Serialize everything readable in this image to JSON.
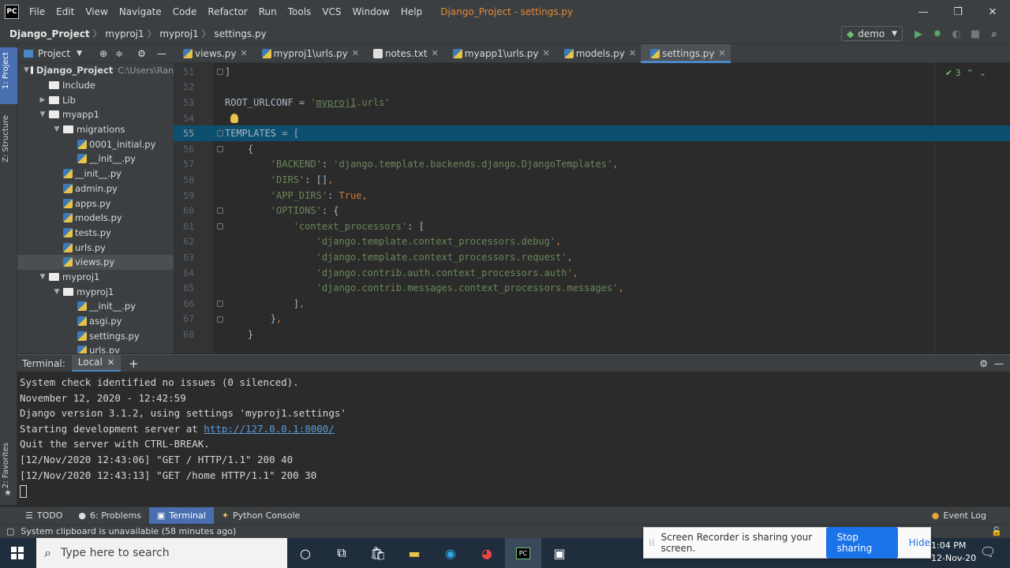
{
  "titlebar": {
    "logo": "PC",
    "menu": [
      "File",
      "Edit",
      "View",
      "Navigate",
      "Code",
      "Refactor",
      "Run",
      "Tools",
      "VCS",
      "Window",
      "Help"
    ],
    "title": "Django_Project - settings.py",
    "controls": [
      "—",
      "❐",
      "✕"
    ]
  },
  "navbar": {
    "crumbs": [
      "Django_Project",
      "myproj1",
      "myproj1",
      "settings.py"
    ],
    "run_config": "demo"
  },
  "left_strip": {
    "tab1": "1: Project",
    "tab2": "Z: Structure",
    "tab3": "2: Favorites"
  },
  "project_panel": {
    "title": "Project",
    "tree": [
      {
        "indent": 0,
        "type": "folder",
        "label": "Django_Project",
        "path": "C:\\Users\\Ran",
        "expanded": true,
        "bold": true
      },
      {
        "indent": 1,
        "type": "folder",
        "label": "Include"
      },
      {
        "indent": 1,
        "type": "folder",
        "label": "Lib",
        "collapsed": true
      },
      {
        "indent": 1,
        "type": "folder",
        "label": "myapp1",
        "expanded": true
      },
      {
        "indent": 2,
        "type": "folder",
        "label": "migrations",
        "expanded": true
      },
      {
        "indent": 3,
        "type": "py",
        "label": "0001_initial.py"
      },
      {
        "indent": 3,
        "type": "py",
        "label": "__init__.py"
      },
      {
        "indent": 2,
        "type": "py",
        "label": "__init__.py"
      },
      {
        "indent": 2,
        "type": "py",
        "label": "admin.py"
      },
      {
        "indent": 2,
        "type": "py",
        "label": "apps.py"
      },
      {
        "indent": 2,
        "type": "py",
        "label": "models.py"
      },
      {
        "indent": 2,
        "type": "py",
        "label": "tests.py"
      },
      {
        "indent": 2,
        "type": "py",
        "label": "urls.py"
      },
      {
        "indent": 2,
        "type": "py",
        "label": "views.py",
        "selected": true
      },
      {
        "indent": 1,
        "type": "folder",
        "label": "myproj1",
        "expanded": true
      },
      {
        "indent": 2,
        "type": "folder",
        "label": "myproj1",
        "expanded": true
      },
      {
        "indent": 3,
        "type": "py",
        "label": "__init__.py"
      },
      {
        "indent": 3,
        "type": "py",
        "label": "asgi.py"
      },
      {
        "indent": 3,
        "type": "py",
        "label": "settings.py"
      },
      {
        "indent": 3,
        "type": "py",
        "label": "urls.py"
      }
    ]
  },
  "tabs": [
    {
      "label": "views.py"
    },
    {
      "label": "myproj1\\urls.py"
    },
    {
      "label": "notes.txt"
    },
    {
      "label": "myapp1\\urls.py"
    },
    {
      "label": "models.py"
    },
    {
      "label": "settings.py",
      "active": true
    }
  ],
  "editor": {
    "inspection_count": "3",
    "lines": [
      {
        "n": "51",
        "html": "]"
      },
      {
        "n": "52",
        "html": ""
      },
      {
        "n": "53",
        "html": "ROOT_URLCONF = <span class=\"s\">'<span class=\"u\">myproj1</span>.urls'</span>"
      },
      {
        "n": "54",
        "html": ""
      },
      {
        "n": "55",
        "html": "TEMPLATES = [",
        "current": true
      },
      {
        "n": "56",
        "html": "    {"
      },
      {
        "n": "57",
        "html": "        <span class=\"s\">'BACKEND'</span>: <span class=\"s\">'django.template.backends.django.DjangoTemplates'</span><span class=\"k\">,</span>"
      },
      {
        "n": "58",
        "html": "        <span class=\"s\">'DIRS'</span>: []<span class=\"k\">,</span>"
      },
      {
        "n": "59",
        "html": "        <span class=\"s\">'APP_DIRS'</span>: <span class=\"k\">True,</span>"
      },
      {
        "n": "60",
        "html": "        <span class=\"s\">'OPTIONS'</span>: {"
      },
      {
        "n": "61",
        "html": "            <span class=\"s\">'context_processors'</span>: ["
      },
      {
        "n": "62",
        "html": "                <span class=\"s\">'django.template.context_processors.debug'</span><span class=\"k\">,</span>"
      },
      {
        "n": "63",
        "html": "                <span class=\"s\">'django.template.context_processors.request'</span><span class=\"k\">,</span>"
      },
      {
        "n": "64",
        "html": "                <span class=\"s\">'django.contrib.auth.context_processors.auth'</span><span class=\"k\">,</span>"
      },
      {
        "n": "65",
        "html": "                <span class=\"s\">'django.contrib.messages.context_processors.messages'</span><span class=\"k\">,</span>"
      },
      {
        "n": "66",
        "html": "            ]<span class=\"k\">,</span>"
      },
      {
        "n": "67",
        "html": "        }<span class=\"k\">,</span>"
      },
      {
        "n": "68",
        "html": "    }"
      }
    ]
  },
  "terminal": {
    "label": "Terminal:",
    "tab": "Local",
    "lines": [
      "System check identified no issues (0 silenced).",
      "November 12, 2020 - 12:42:59",
      "Django version 3.1.2, using settings 'myproj1.settings'",
      "Quit the server with CTRL-BREAK.",
      "[12/Nov/2020 12:43:06] \"GET / HTTP/1.1\" 200 40",
      "[12/Nov/2020 12:43:13] \"GET /home HTTP/1.1\" 200 30"
    ],
    "server_prefix": "Starting development server at ",
    "server_url": "http://127.0.0.1:8000/"
  },
  "toolbar": {
    "todo": "TODO",
    "problems": "6: Problems",
    "terminal": "Terminal",
    "python_console": "Python Console",
    "event_log": "Event Log"
  },
  "status": {
    "message": "System clipboard is unavailable (58 minutes ago)"
  },
  "taskbar": {
    "search_placeholder": "Type here to search"
  },
  "notification": {
    "text": "Screen Recorder is sharing your screen.",
    "stop": "Stop sharing",
    "hide": "Hide"
  },
  "clock": {
    "time": "1:04 PM",
    "date": "12-Nov-20"
  }
}
